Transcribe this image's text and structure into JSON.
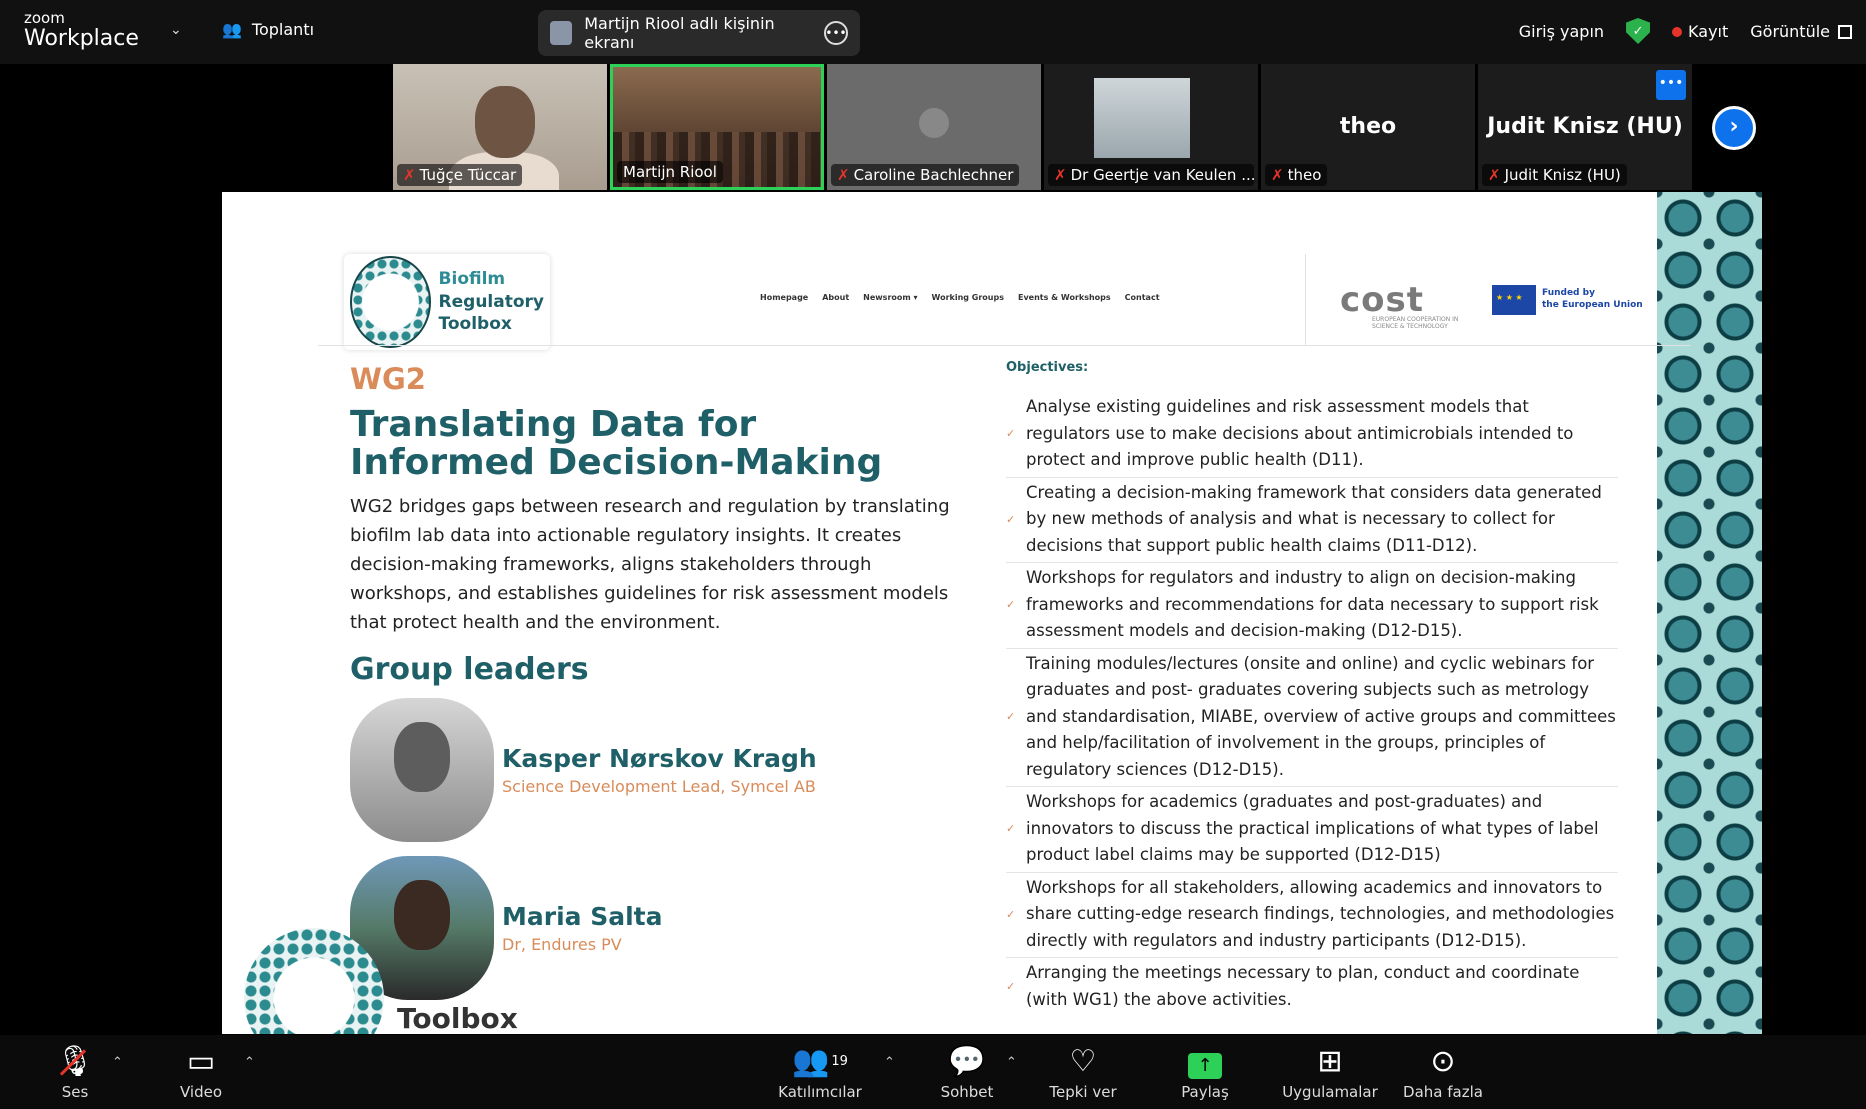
{
  "app": {
    "brand_top": "zoom",
    "brand_bottom": "Workplace",
    "meeting_label": "Toplantı",
    "share_banner": "Martijn Riool adlı kişinin ekranı",
    "sign_in": "Giriş yapın",
    "record": "Kayıt",
    "view": "Görüntüle",
    "colors": {
      "accent_blue": "#0e72ed",
      "active_green": "#2ed158",
      "mute_red": "#e5352b"
    }
  },
  "participants": [
    {
      "name": "Tuğçe Tüccar"
    },
    {
      "name": "Martijn Riool"
    },
    {
      "name": "Caroline Bachlechner"
    },
    {
      "name": "Dr Geertje van Keulen ..."
    },
    {
      "name": "theo",
      "display": "theo"
    },
    {
      "name": "Judit Knisz (HU)",
      "display": "Judit Knisz (HU)"
    }
  ],
  "slide": {
    "logo": {
      "line1": "Biofilm",
      "line2": "Regulatory",
      "line3": "Toolbox"
    },
    "nav": [
      "Homepage",
      "About",
      "Newsroom ▾",
      "Working Groups",
      "Events & Workshops",
      "Contact"
    ],
    "cost": "cost",
    "cost_sub": "EUROPEAN COOPERATION IN SCIENCE & TECHNOLOGY",
    "eu_line1": "Funded by",
    "eu_line2": "the European Union",
    "wg": "WG2",
    "title": "Translating Data for Informed Decision-Making",
    "description": "WG2 bridges gaps between research and regulation by translating biofilm lab data into actionable regulatory insights. It creates decision-making frameworks, aligns stakeholders through workshops, and establishes guidelines for risk assessment models that protect health and the environment.",
    "group_leaders_heading": "Group leaders",
    "leaders": [
      {
        "name": "Kasper Nørskov Kragh",
        "role": "Science Development Lead, Symcel AB"
      },
      {
        "name": "Maria Salta",
        "role": "Dr, Endures PV"
      }
    ],
    "objectives_heading": "Objectives:",
    "objectives": [
      "Analyse existing guidelines and risk assessment models that regulators use to make decisions about antimicrobials intended to protect and improve public health (D11).",
      "Creating a decision-making framework that considers data generated by new methods of analysis and what is necessary to collect for decisions that support public health claims (D11-D12).",
      "Workshops for regulators and industry to align on decision-making frameworks and recommendations for data necessary to support risk assessment models and decision-making (D12-D15).",
      "Training modules/lectures (onsite and online) and cyclic webinars for graduates and post- graduates covering subjects such as metrology and standardisation, MIABE, overview of active groups and committees and help/facilitation of involvement in the groups, principles of regulatory sciences (D12-D15).",
      "Workshops for academics (graduates and post-graduates) and innovators to discuss the practical implications of what types of label product label claims may be supported (D12-D15)",
      "Workshops for all stakeholders, allowing academics and innovators to share cutting-edge research findings, technologies, and methodologies directly with regulators and industry participants (D12-D15).",
      "Arranging the meetings necessary to plan, conduct and coordinate (with WG1) the above activities."
    ],
    "corner_text": "Toolbox"
  },
  "toolbar": {
    "audio": "Ses",
    "video": "Video",
    "participants": "Katılımcılar",
    "participants_count": "19",
    "chat": "Sohbet",
    "react": "Tepki ver",
    "share": "Paylaş",
    "apps": "Uygulamalar",
    "more": "Daha fazla"
  }
}
